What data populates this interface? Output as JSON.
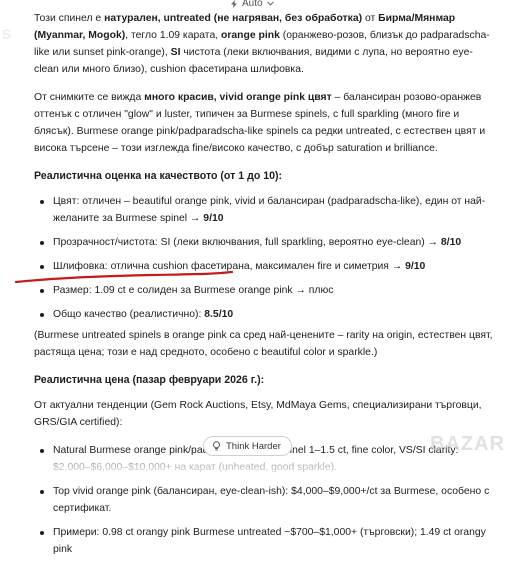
{
  "header": {
    "auto_label": "Auto"
  },
  "watermark": {
    "text": "BAZAR",
    "left_text": "S"
  },
  "intro": {
    "p1": [
      {
        "t": "Този спинел е "
      },
      {
        "t": "натурален, untreated (не нагряван, без обработка)",
        "b": true
      },
      {
        "t": " от "
      },
      {
        "t": "Бирма/Мянмар (Myanmar, Mogok)",
        "b": true
      },
      {
        "t": ", тегло 1.09 карата, "
      },
      {
        "t": "orange pink",
        "b": true
      },
      {
        "t": " (оранжево-розов, близък до padparadscha-like или sunset pink-orange), "
      },
      {
        "t": "SI",
        "b": true
      },
      {
        "t": " чистота (леки включвания, видими с лупа, но вероятно eye-clean или много близо), cushion фасетирана шлифовка."
      }
    ],
    "p2": [
      {
        "t": "От снимките се вижда "
      },
      {
        "t": "много красив, vivid orange pink цвят",
        "b": true
      },
      {
        "t": " – балансиран розово-оранжев оттенък с отличен \"glow\" и luster, типичен за Burmese spinels, с full sparkling (много fire и блясък). Burmese orange pink/padparadscha-like spinels са редки untreated, с естествен цвят и висока търсене – този изглежда fine/високо качество, с добър saturation и brilliance."
      }
    ]
  },
  "quality": {
    "heading": "Реалистична оценка на качеството (от 1 до 10):",
    "items": [
      [
        {
          "t": "Цвят: отличен – beautiful orange pink, vivid и балансиран (padparadscha-like), един от най-желаните за Burmese spinel → "
        },
        {
          "t": "9/10",
          "b": true
        }
      ],
      [
        {
          "t": "Прозрачност/чистота: SI (леки включвания, full sparkling, вероятно eye-clean) → "
        },
        {
          "t": "8/10",
          "b": true
        }
      ],
      [
        {
          "t": "Шлифовка: отлична cushion фасетирана, максимален fire и симетрия → "
        },
        {
          "t": "9/10",
          "b": true
        }
      ],
      [
        {
          "t": "Размер: 1.09 ct е солиден за Burmese orange pink → плюс"
        }
      ],
      [
        {
          "t": "Общо качество (реалистично): "
        },
        {
          "t": "8.5/10",
          "b": true
        }
      ]
    ],
    "note": "(Burmese untreated spinels в orange pink са сред най-ценените – rarity на origin, естествен цвят, растяща цена; този е над средното, особено с beautiful color и sparkle.)"
  },
  "price": {
    "heading": "Реалистична цена (пазар февруари 2026 г.):",
    "intro": "От актуални тенденции (Gem Rock Auctions, Etsy, MdMaya Gems, специализирани търговци, GRS/GIA certified):",
    "items": [
      [
        {
          "t": "Natural Burmese orange pink/padparadscha-like spinel 1–1.5 ct, fine color, VS/SI clarity: $2,000–$6,000–$10,000+ на карат (unheated, good sparkle)."
        }
      ],
      [
        {
          "t": "Top vivid orange pink (балансиран, eye-clean-ish): $4,000–$9,000+/ct за Burmese, особено с сертификат."
        }
      ],
      [
        {
          "t": "Примери: 0.98 ct orangy pink Burmese untreated ~$700–$1,000+ (търговски); 1.49 ct orangy pink"
        }
      ]
    ]
  },
  "think_button": {
    "label": "Think Harder"
  }
}
